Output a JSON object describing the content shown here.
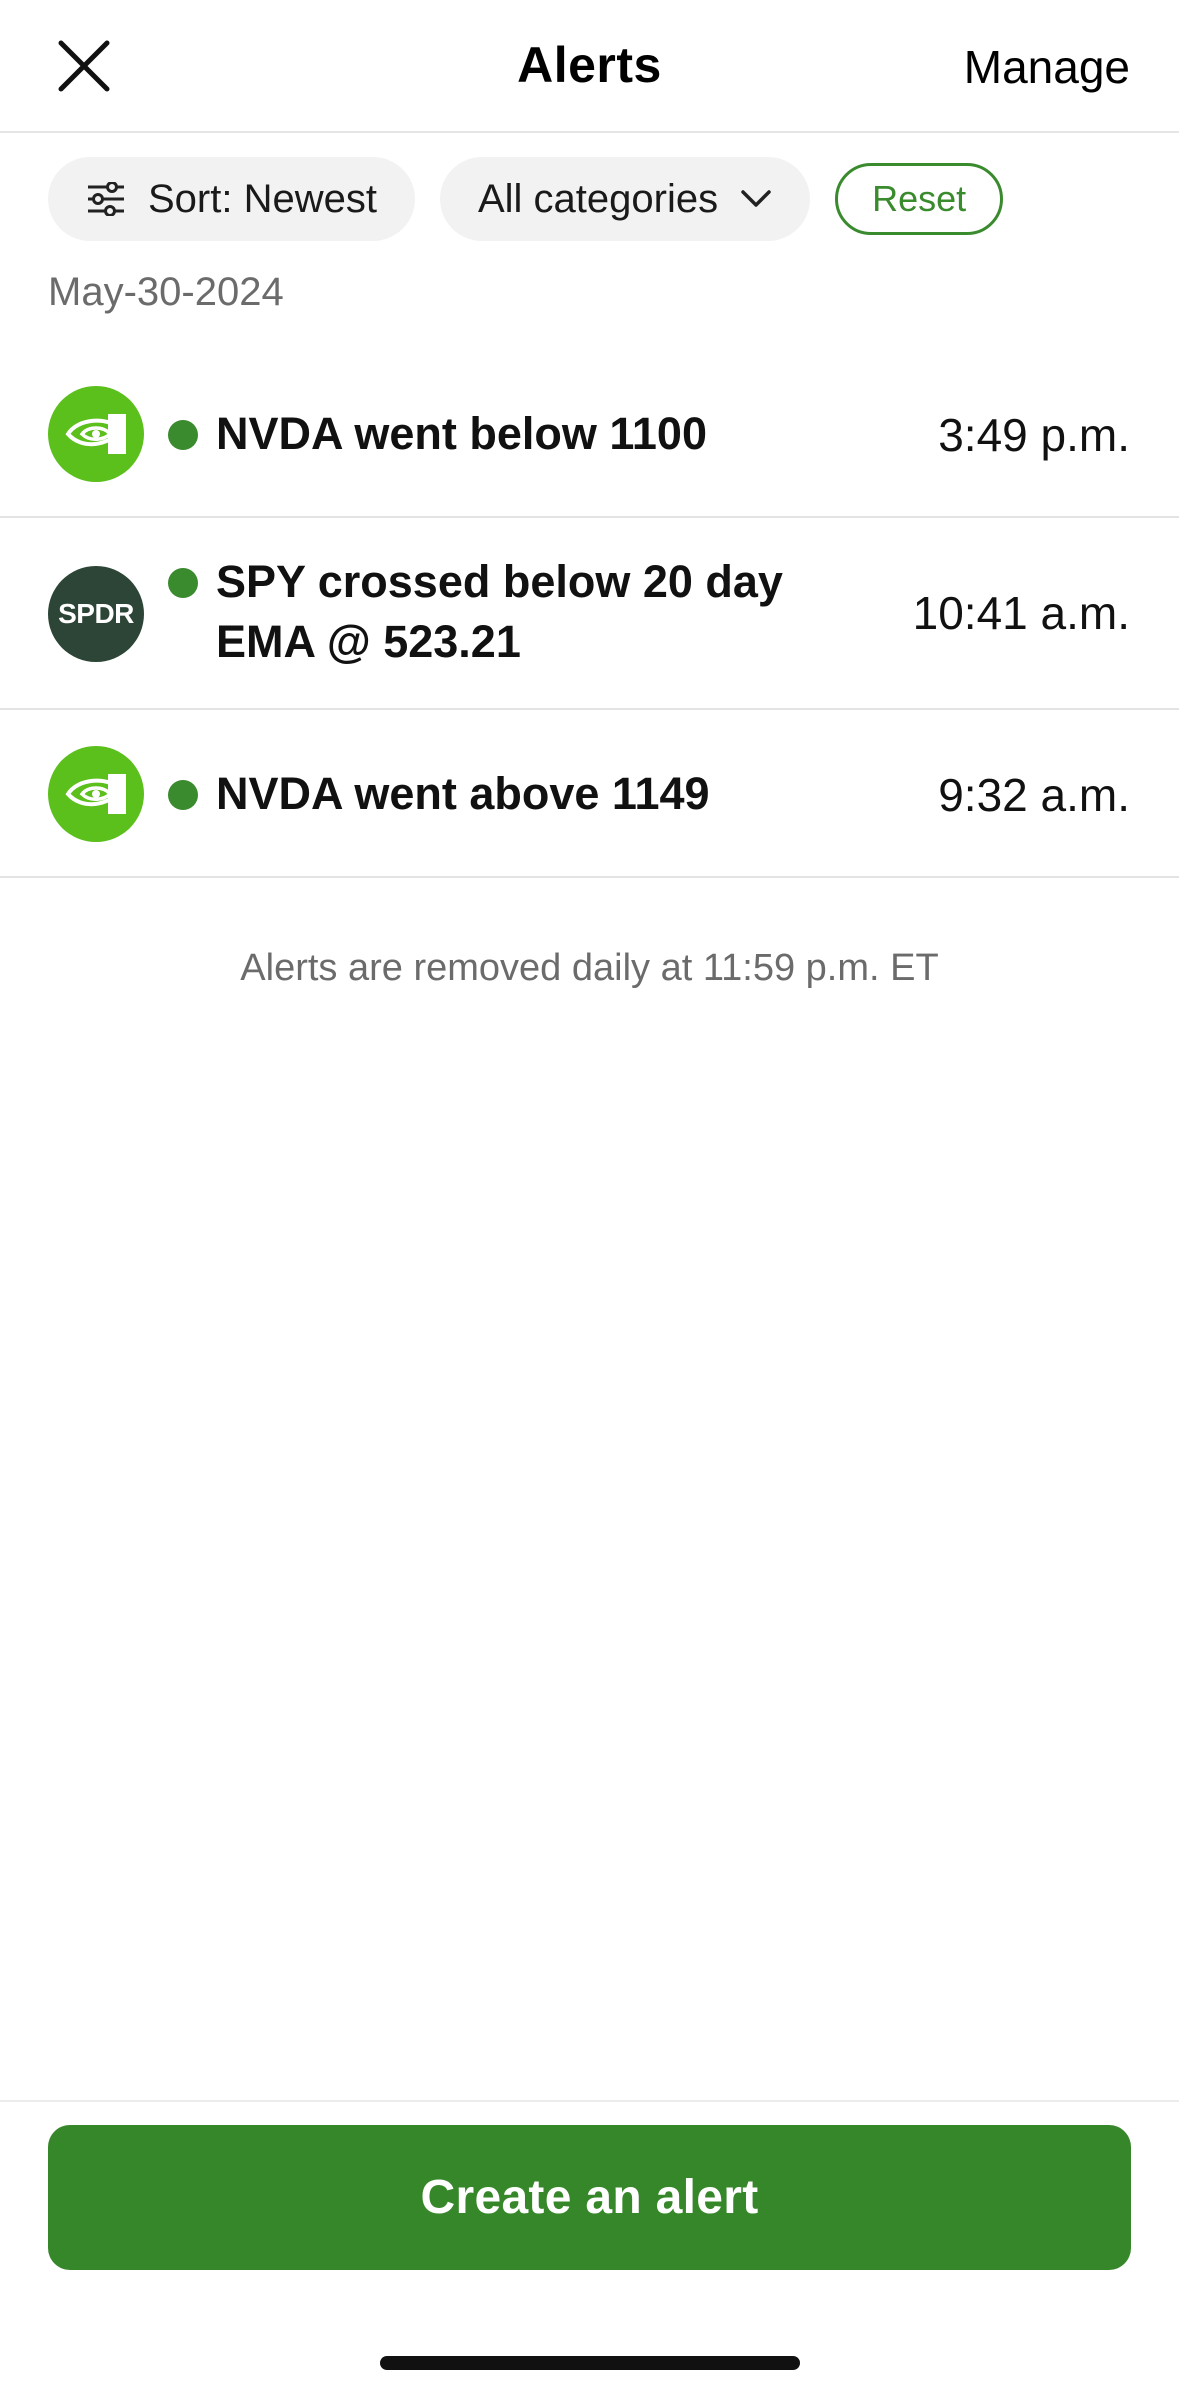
{
  "header": {
    "title": "Alerts",
    "manage_label": "Manage"
  },
  "filters": {
    "sort_label": "Sort: Newest",
    "category_label": "All categories",
    "reset_label": "Reset"
  },
  "date_heading": "May-30-2024",
  "alerts": [
    {
      "logo": "nvidia-logo",
      "message": "NVDA went below 1100",
      "time": "3:49 p.m."
    },
    {
      "logo": "spdr-logo",
      "logo_text": "SPDR",
      "message": " SPY crossed below 20 day EMA @ 523.21",
      "time": "10:41 a.m."
    },
    {
      "logo": "nvidia-logo",
      "message": "NVDA went above 1149",
      "time": "9:32 a.m."
    }
  ],
  "footer_note": "Alerts are removed daily at 11:59 p.m. ET",
  "cta_label": "Create an alert",
  "colors": {
    "accent_green": "#368729",
    "unread_dot": "#3a8a2e",
    "nvidia_green": "#5bbf1c",
    "spdr_dark": "#2c4536"
  },
  "icons": {
    "close": "close-icon",
    "sort": "sliders-icon",
    "category": "chevron-down-icon"
  }
}
